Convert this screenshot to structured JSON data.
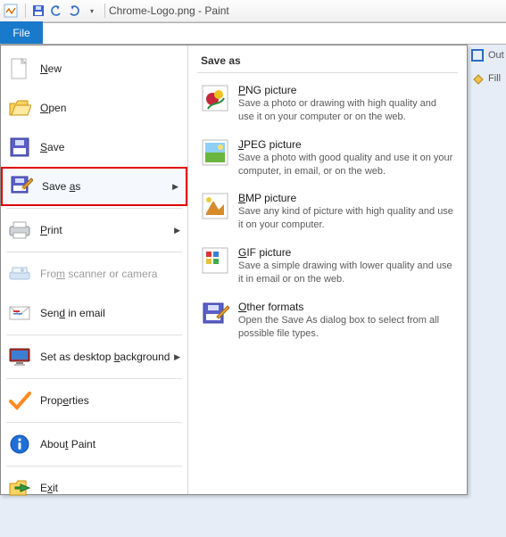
{
  "title": "Chrome-Logo.png - Paint",
  "file_tab": "File",
  "menu": {
    "new": "New",
    "open": "Open",
    "save": "Save",
    "saveas": "Save as",
    "print": "Print",
    "scanner": "From scanner or camera",
    "email": "Send in email",
    "wallpaper": "Set as desktop background",
    "properties": "Properties",
    "about": "About Paint",
    "exit": "Exit"
  },
  "submenu": {
    "header": "Save as",
    "png_t": "PNG picture",
    "png_d": "Save a photo or drawing with high quality and use it on your computer or on the web.",
    "jpg_t": "JPEG picture",
    "jpg_d": "Save a photo with good quality and use it on your computer, in email, or on the web.",
    "bmp_t": "BMP picture",
    "bmp_d": "Save any kind of picture with high quality and use it on your computer.",
    "gif_t": "GIF picture",
    "gif_d": "Save a simple drawing with lower quality and use it in email or on the web.",
    "oth_t": "Other formats",
    "oth_d": "Open the Save As dialog box to select from all possible file types."
  },
  "side": {
    "outline": "Out",
    "fill": "Fill"
  }
}
